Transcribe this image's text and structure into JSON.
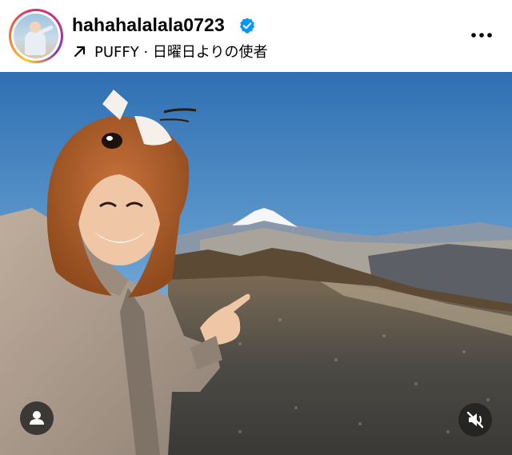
{
  "post": {
    "username": "hahahalalala0723",
    "music_label": "PUFFY · 日曜日よりの使者",
    "verified": true
  },
  "icons": {
    "avatar": "profile-avatar",
    "verified": "verified-badge-icon",
    "music": "arrow-up-right-icon",
    "more": "more-options-icon",
    "user_tag": "user-tag-icon",
    "mute": "muted-speaker-icon"
  },
  "colors": {
    "verified_blue": "#0095f6",
    "sky_top": "#2f6fb2",
    "sky_bottom": "#c9dbe9",
    "hat_brown": "#b8642a"
  }
}
